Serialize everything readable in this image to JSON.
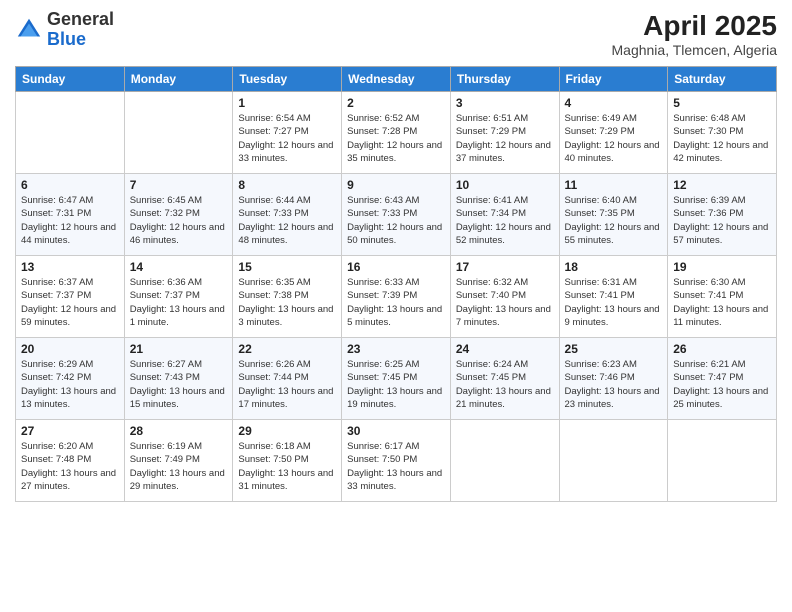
{
  "header": {
    "logo_line1": "General",
    "logo_line2": "Blue",
    "month_title": "April 2025",
    "location": "Maghnia, Tlemcen, Algeria"
  },
  "days_of_week": [
    "Sunday",
    "Monday",
    "Tuesday",
    "Wednesday",
    "Thursday",
    "Friday",
    "Saturday"
  ],
  "weeks": [
    [
      {
        "day": "",
        "info": ""
      },
      {
        "day": "",
        "info": ""
      },
      {
        "day": "1",
        "info": "Sunrise: 6:54 AM\nSunset: 7:27 PM\nDaylight: 12 hours and 33 minutes."
      },
      {
        "day": "2",
        "info": "Sunrise: 6:52 AM\nSunset: 7:28 PM\nDaylight: 12 hours and 35 minutes."
      },
      {
        "day": "3",
        "info": "Sunrise: 6:51 AM\nSunset: 7:29 PM\nDaylight: 12 hours and 37 minutes."
      },
      {
        "day": "4",
        "info": "Sunrise: 6:49 AM\nSunset: 7:29 PM\nDaylight: 12 hours and 40 minutes."
      },
      {
        "day": "5",
        "info": "Sunrise: 6:48 AM\nSunset: 7:30 PM\nDaylight: 12 hours and 42 minutes."
      }
    ],
    [
      {
        "day": "6",
        "info": "Sunrise: 6:47 AM\nSunset: 7:31 PM\nDaylight: 12 hours and 44 minutes."
      },
      {
        "day": "7",
        "info": "Sunrise: 6:45 AM\nSunset: 7:32 PM\nDaylight: 12 hours and 46 minutes."
      },
      {
        "day": "8",
        "info": "Sunrise: 6:44 AM\nSunset: 7:33 PM\nDaylight: 12 hours and 48 minutes."
      },
      {
        "day": "9",
        "info": "Sunrise: 6:43 AM\nSunset: 7:33 PM\nDaylight: 12 hours and 50 minutes."
      },
      {
        "day": "10",
        "info": "Sunrise: 6:41 AM\nSunset: 7:34 PM\nDaylight: 12 hours and 52 minutes."
      },
      {
        "day": "11",
        "info": "Sunrise: 6:40 AM\nSunset: 7:35 PM\nDaylight: 12 hours and 55 minutes."
      },
      {
        "day": "12",
        "info": "Sunrise: 6:39 AM\nSunset: 7:36 PM\nDaylight: 12 hours and 57 minutes."
      }
    ],
    [
      {
        "day": "13",
        "info": "Sunrise: 6:37 AM\nSunset: 7:37 PM\nDaylight: 12 hours and 59 minutes."
      },
      {
        "day": "14",
        "info": "Sunrise: 6:36 AM\nSunset: 7:37 PM\nDaylight: 13 hours and 1 minute."
      },
      {
        "day": "15",
        "info": "Sunrise: 6:35 AM\nSunset: 7:38 PM\nDaylight: 13 hours and 3 minutes."
      },
      {
        "day": "16",
        "info": "Sunrise: 6:33 AM\nSunset: 7:39 PM\nDaylight: 13 hours and 5 minutes."
      },
      {
        "day": "17",
        "info": "Sunrise: 6:32 AM\nSunset: 7:40 PM\nDaylight: 13 hours and 7 minutes."
      },
      {
        "day": "18",
        "info": "Sunrise: 6:31 AM\nSunset: 7:41 PM\nDaylight: 13 hours and 9 minutes."
      },
      {
        "day": "19",
        "info": "Sunrise: 6:30 AM\nSunset: 7:41 PM\nDaylight: 13 hours and 11 minutes."
      }
    ],
    [
      {
        "day": "20",
        "info": "Sunrise: 6:29 AM\nSunset: 7:42 PM\nDaylight: 13 hours and 13 minutes."
      },
      {
        "day": "21",
        "info": "Sunrise: 6:27 AM\nSunset: 7:43 PM\nDaylight: 13 hours and 15 minutes."
      },
      {
        "day": "22",
        "info": "Sunrise: 6:26 AM\nSunset: 7:44 PM\nDaylight: 13 hours and 17 minutes."
      },
      {
        "day": "23",
        "info": "Sunrise: 6:25 AM\nSunset: 7:45 PM\nDaylight: 13 hours and 19 minutes."
      },
      {
        "day": "24",
        "info": "Sunrise: 6:24 AM\nSunset: 7:45 PM\nDaylight: 13 hours and 21 minutes."
      },
      {
        "day": "25",
        "info": "Sunrise: 6:23 AM\nSunset: 7:46 PM\nDaylight: 13 hours and 23 minutes."
      },
      {
        "day": "26",
        "info": "Sunrise: 6:21 AM\nSunset: 7:47 PM\nDaylight: 13 hours and 25 minutes."
      }
    ],
    [
      {
        "day": "27",
        "info": "Sunrise: 6:20 AM\nSunset: 7:48 PM\nDaylight: 13 hours and 27 minutes."
      },
      {
        "day": "28",
        "info": "Sunrise: 6:19 AM\nSunset: 7:49 PM\nDaylight: 13 hours and 29 minutes."
      },
      {
        "day": "29",
        "info": "Sunrise: 6:18 AM\nSunset: 7:50 PM\nDaylight: 13 hours and 31 minutes."
      },
      {
        "day": "30",
        "info": "Sunrise: 6:17 AM\nSunset: 7:50 PM\nDaylight: 13 hours and 33 minutes."
      },
      {
        "day": "",
        "info": ""
      },
      {
        "day": "",
        "info": ""
      },
      {
        "day": "",
        "info": ""
      }
    ]
  ]
}
